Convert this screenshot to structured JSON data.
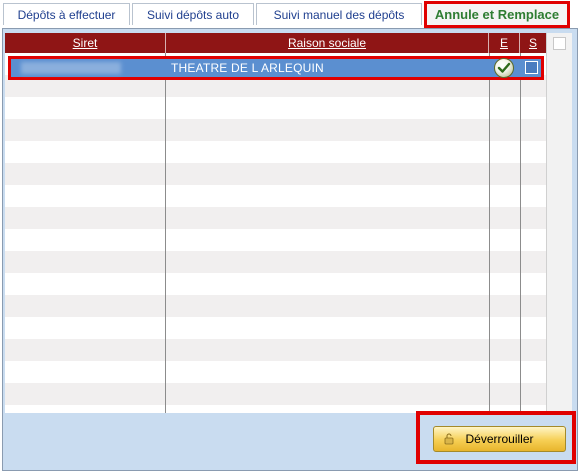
{
  "tabs": [
    {
      "label": "Dépôts à effectuer"
    },
    {
      "label": "Suivi dépôts auto"
    },
    {
      "label": "Suivi manuel des dépôts"
    },
    {
      "label": "Annule et Remplace"
    }
  ],
  "table": {
    "columns": [
      "Siret",
      "Raison sociale",
      "E",
      "S"
    ],
    "rows": [
      {
        "siret": "",
        "raison_sociale": "THEATRE DE L ARLEQUIN",
        "e_checked": true,
        "s_checked": false
      }
    ]
  },
  "actions": {
    "unlock_label": "Déverrouiller"
  },
  "colors": {
    "header_bg": "#8f1515",
    "selected_row": "#5b8fd0",
    "highlight": "#e00000",
    "active_tab_text": "#2e7d32"
  }
}
